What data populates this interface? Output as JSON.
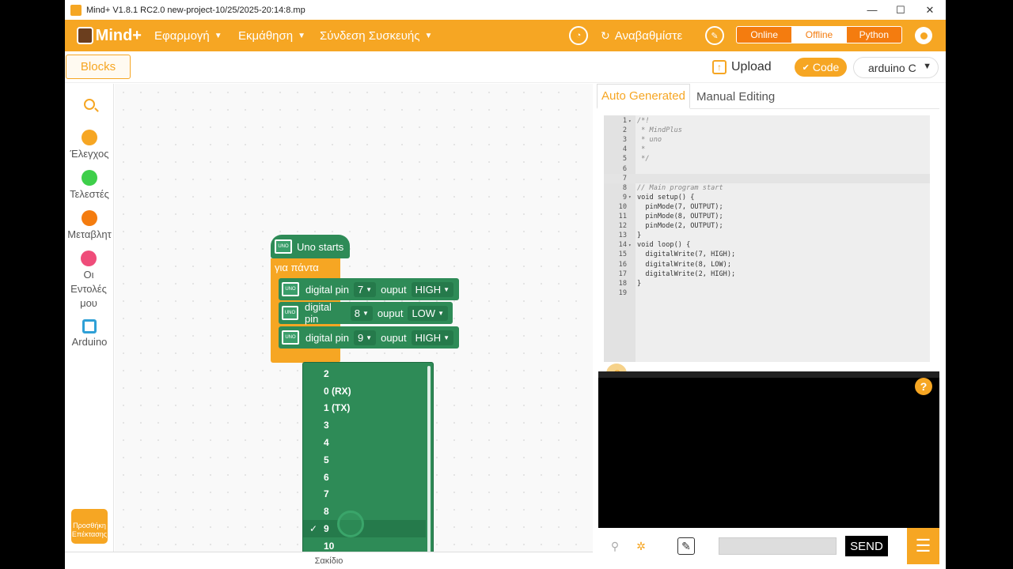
{
  "window": {
    "title": "Mind+ V1.8.1 RC2.0  new-project-10/25/2025-20:14:8.mp",
    "minimize": "—",
    "maximize": "☐",
    "close": "✕"
  },
  "menubar": {
    "logo": "Mind+",
    "items": [
      {
        "label": "Εφαρμογή"
      },
      {
        "label": "Εκμάθηση"
      },
      {
        "label": "Σύνδεση Συσκευής"
      }
    ],
    "upgrade_label": "Αναβαθμίστε",
    "modes": [
      "Online",
      "Offline",
      "Python"
    ],
    "active_mode": "Offline"
  },
  "toolbar2": {
    "blocks_tab": "Blocks",
    "upload": "Upload",
    "code": "Code",
    "device": "arduino C"
  },
  "sidebar": {
    "categories": [
      {
        "label": "Έλεγχος",
        "color": "#f6a623"
      },
      {
        "label": "Τελεστές",
        "color": "#3ecf4a"
      },
      {
        "label": "Μεταβλητ",
        "color": "#f47c0f"
      },
      {
        "label": "Οι Εντολές μου",
        "color": "#ef4d7a"
      },
      {
        "label": "Arduino",
        "color": "#2fa0d6"
      }
    ],
    "extension_label": "Προσθήκη Επέκτασης"
  },
  "workspace": {
    "hat_label": "Uno starts",
    "forever_label": "για πάντα",
    "blocks": [
      {
        "label": "digital pin",
        "pin": "7",
        "out_label": "ouput",
        "level": "HIGH"
      },
      {
        "label": "digital pin",
        "pin": "8",
        "out_label": "ouput",
        "level": "LOW"
      },
      {
        "label": "digital pin",
        "pin": "9",
        "out_label": "ouput",
        "level": "HIGH"
      }
    ],
    "dropdown_options": [
      "2",
      "0 (RX)",
      "1 (TX)",
      "3",
      "4",
      "5",
      "6",
      "7",
      "8",
      "9",
      "10"
    ],
    "selected_option": "9",
    "bottom_label": "Σακίδιο",
    "uno_icon_text": "UNO"
  },
  "code_panel": {
    "tabs": [
      "Auto Generated",
      "Manual Editing"
    ],
    "active_tab": "Auto Generated",
    "lines": [
      {
        "n": "1",
        "fold": "▾",
        "text": "/*!"
      },
      {
        "n": "2",
        "fold": "",
        "text": " * MindPlus"
      },
      {
        "n": "3",
        "fold": "",
        "text": " * uno"
      },
      {
        "n": "4",
        "fold": "",
        "text": " *"
      },
      {
        "n": "5",
        "fold": "",
        "text": " */"
      },
      {
        "n": "6",
        "fold": "",
        "text": ""
      },
      {
        "n": "7",
        "fold": "",
        "text": ""
      },
      {
        "n": "8",
        "fold": "",
        "text": "// Main program start"
      },
      {
        "n": "9",
        "fold": "▾",
        "text": "void setup() {"
      },
      {
        "n": "10",
        "fold": "",
        "text": "  pinMode(7, OUTPUT);"
      },
      {
        "n": "11",
        "fold": "",
        "text": "  pinMode(8, OUTPUT);"
      },
      {
        "n": "12",
        "fold": "",
        "text": "  pinMode(2, OUTPUT);"
      },
      {
        "n": "13",
        "fold": "",
        "text": "}"
      },
      {
        "n": "14",
        "fold": "▾",
        "text": "void loop() {"
      },
      {
        "n": "15",
        "fold": "",
        "text": "  digitalWrite(7, HIGH);"
      },
      {
        "n": "16",
        "fold": "",
        "text": "  digitalWrite(8, LOW);"
      },
      {
        "n": "17",
        "fold": "",
        "text": "  digitalWrite(2, HIGH);"
      },
      {
        "n": "18",
        "fold": "",
        "text": "}"
      },
      {
        "n": "19",
        "fold": "",
        "text": ""
      }
    ]
  },
  "serial": {
    "help": "?",
    "send": "SEND"
  },
  "colors": {
    "accent": "#f6a623",
    "block_green": "#2e8b57"
  }
}
